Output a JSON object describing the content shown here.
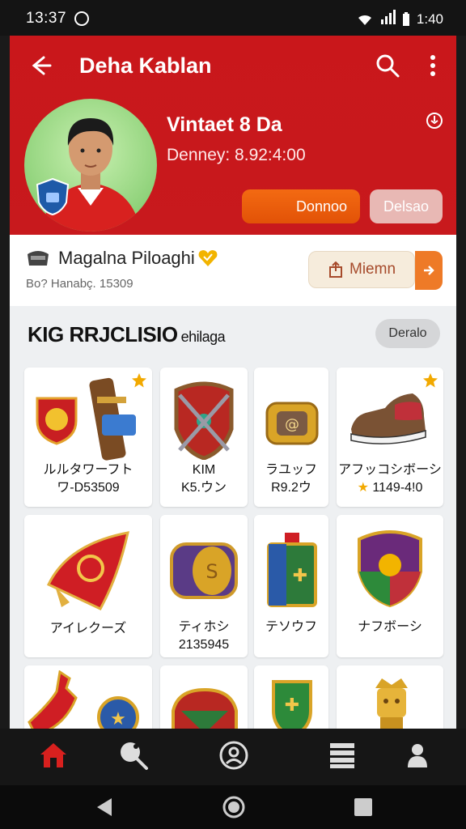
{
  "status_bar": {
    "time_left": "13:37",
    "time_right": "1:40"
  },
  "header": {
    "title": "Deha Kablan"
  },
  "profile": {
    "name": "Vintaet 8 Da",
    "subtitle": "Denney: 8.92:4:00",
    "btn_primary": "Donnoo",
    "btn_secondary": "Delsao"
  },
  "user_row": {
    "name": "Magalna Piloaghi",
    "id": "Bo? Hanabç. 15309",
    "action": "Miemn"
  },
  "section": {
    "title": "KIG RRJCLISIO",
    "title_suffix": "ehilaga",
    "details": "Deralo"
  },
  "items": [
    {
      "line1": "ルルタワーフト",
      "line2": "ワ-D53509",
      "star": true
    },
    {
      "line1": "KIM",
      "line2": "K5.ウン",
      "star": false
    },
    {
      "line1": "ラユッフ",
      "line2": "R9.2ウ",
      "star": false
    },
    {
      "line1": "アフッコシボーシ",
      "line2": "1149-4!0",
      "star": true
    },
    {
      "line1": "アイレクーズ",
      "line2": "",
      "star": false
    },
    {
      "line1": "ティホシ",
      "line2": "2135945",
      "star": false
    },
    {
      "line1": "テソウフ",
      "line2": "",
      "star": false
    },
    {
      "line1": "ナフボーシ",
      "line2": "",
      "star": false
    }
  ],
  "colors": {
    "brand_red": "#c9171b",
    "orange": "#e85a0a",
    "accent_yellow": "#f2b400"
  }
}
